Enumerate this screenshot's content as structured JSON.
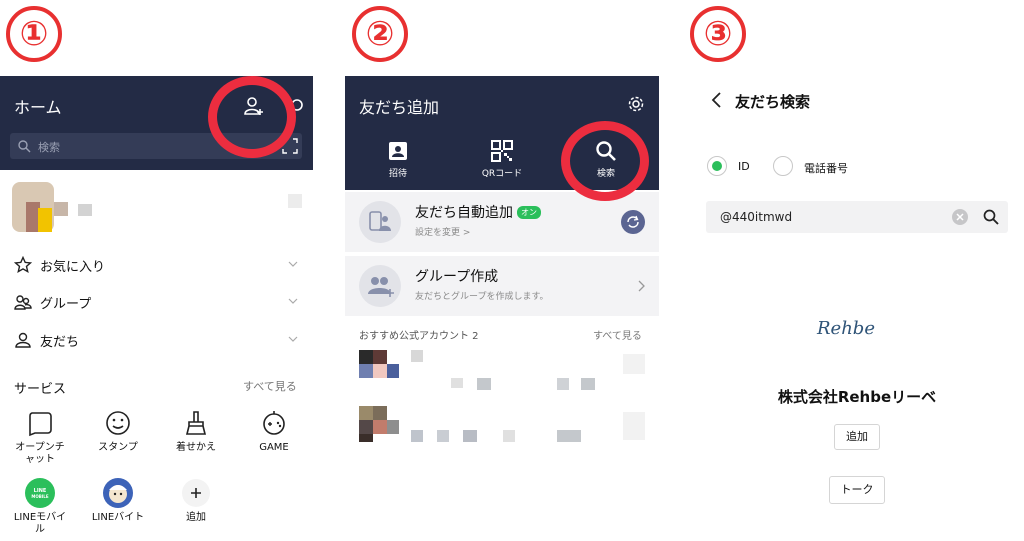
{
  "step_numbers": [
    "①",
    "②",
    "③"
  ],
  "panel1": {
    "title": "ホーム",
    "search_placeholder": "検索",
    "rows": [
      {
        "label": "お気に入り",
        "icon": "star-icon"
      },
      {
        "label": "グループ",
        "icon": "group-icon"
      },
      {
        "label": "友だち",
        "icon": "person-icon"
      }
    ],
    "services_label": "サービス",
    "see_all": "すべて見る",
    "services_row1": [
      {
        "line1": "オープンチ",
        "line2": "ャット",
        "icon": "openchat-icon"
      },
      {
        "line1": "スタンプ",
        "line2": "",
        "icon": "smile-icon"
      },
      {
        "line1": "着せかえ",
        "line2": "",
        "icon": "brush-icon"
      },
      {
        "line1": "GAME",
        "line2": "",
        "icon": "game-icon"
      }
    ],
    "services_row2": [
      {
        "line1": "LINEモバイ",
        "line2": "ル",
        "icon": "line-mobile-icon",
        "badge": "LINE MOBILE"
      },
      {
        "line1": "LINEバイト",
        "line2": "",
        "icon": "line-baito-icon"
      },
      {
        "line1": "追加",
        "line2": "",
        "icon": "plus-icon"
      }
    ]
  },
  "panel2": {
    "title": "友だち追加",
    "actions": [
      {
        "label": "招待",
        "icon": "invite-icon"
      },
      {
        "label": "QRコード",
        "icon": "qr-icon"
      },
      {
        "label": "検索",
        "icon": "search-icon"
      }
    ],
    "auto_add": {
      "title": "友だち自動追加",
      "badge": "オン",
      "subtitle": "設定を変更 >"
    },
    "group": {
      "title": "グループ作成",
      "subtitle": "友だちとグループを作成します。"
    },
    "recommended_label": "おすすめ公式アカウント 2",
    "see_all": "すべて見る"
  },
  "panel3": {
    "title": "友だち検索",
    "radio_id": "ID",
    "radio_phone": "電話番号",
    "search_value": "@440itmwd",
    "logo_text": "Rehbe",
    "company_name": "株式会社Rehbeリーベ",
    "add_button": "追加",
    "talk_button": "トーク"
  },
  "colors": {
    "header_bg": "#232b45",
    "annotation_red": "#ec2d3f",
    "line_green": "#2bbf5b"
  }
}
